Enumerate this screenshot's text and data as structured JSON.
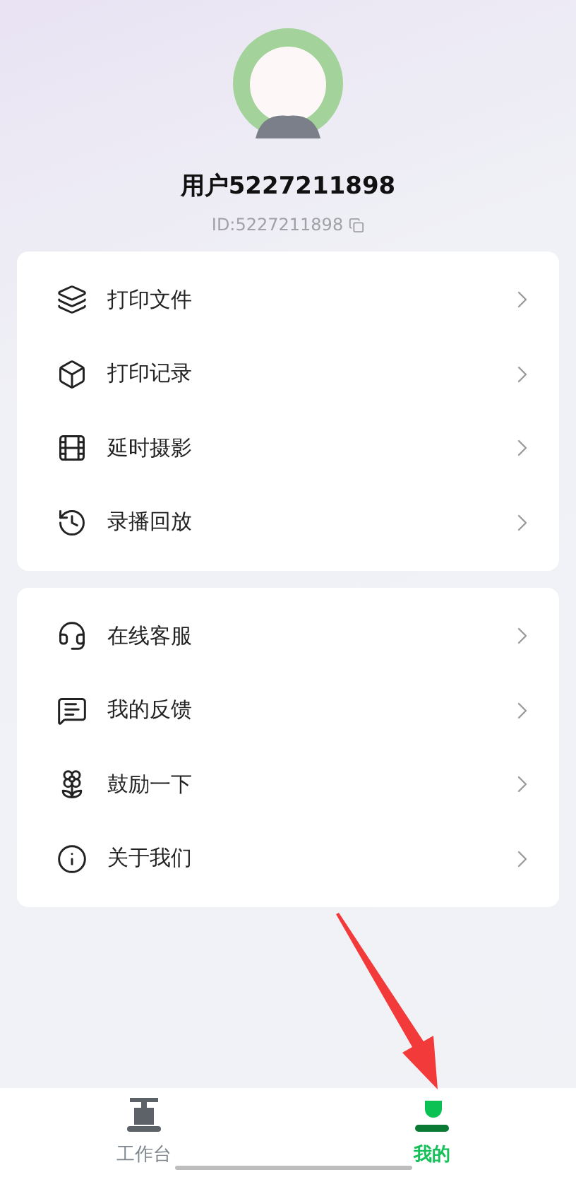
{
  "profile": {
    "name": "用户5227211898",
    "id": "ID:5227211898"
  },
  "menu_groups": [
    {
      "items": [
        {
          "label": "打印文件",
          "kind": "layers"
        },
        {
          "label": "打印记录",
          "kind": "box"
        },
        {
          "label": "延时摄影",
          "kind": "film"
        },
        {
          "label": "录播回放",
          "kind": "replay"
        }
      ]
    },
    {
      "items": [
        {
          "label": "在线客服",
          "kind": "headset"
        },
        {
          "label": "我的反馈",
          "kind": "feedback"
        },
        {
          "label": "鼓励一下",
          "kind": "flower"
        },
        {
          "label": "关于我们",
          "kind": "info"
        }
      ]
    }
  ],
  "tabs": [
    {
      "label": "工作台",
      "kind": "printer",
      "selected": false
    },
    {
      "label": "我的",
      "kind": "person",
      "selected": true
    }
  ]
}
